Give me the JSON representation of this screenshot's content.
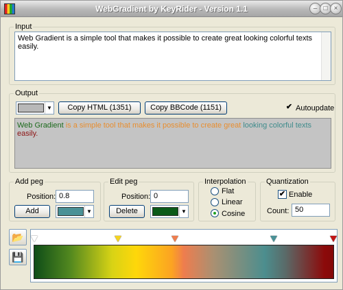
{
  "window": {
    "title": "WebGradient by KeyRider - Version 1.1"
  },
  "input": {
    "label": "Input",
    "text": "Web Gradient is a simple tool that makes it possible to create great looking colorful texts easily."
  },
  "output": {
    "label": "Output",
    "background_color": "#b8b8b8",
    "copy_html": "Copy HTML (1351)",
    "copy_bbcode": "Copy BBCode (1151)",
    "autoupdate": "Autoupdate",
    "autoupdate_checked": true,
    "preview_words": [
      {
        "text": "Web Gradient",
        "color": "#1c6a1c"
      },
      {
        "text": " is a simple tool that makes it possible to create great",
        "color": "#e88d2e"
      },
      {
        "text": " looking colorful texts",
        "color": "#3e8b8b"
      },
      {
        "text": " easily.",
        "color": "#8c1212"
      }
    ]
  },
  "add_peg": {
    "label": "Add peg",
    "position_label": "Position:",
    "position_value": "0.8",
    "add_button": "Add",
    "color": "#4a9196"
  },
  "edit_peg": {
    "label": "Edit peg",
    "position_label": "Position:",
    "position_value": "0",
    "delete_button": "Delete",
    "color": "#0b5a18"
  },
  "interpolation": {
    "label": "Interpolation",
    "options": [
      "Flat",
      "Linear",
      "Cosine"
    ],
    "selected": "Cosine"
  },
  "quantization": {
    "label": "Quantization",
    "enable_label": "Enable",
    "enabled": true,
    "count_label": "Count:",
    "count_value": "50"
  },
  "gradient": {
    "pegs": [
      {
        "position": 0.0,
        "color": "#ffffff",
        "selected": true
      },
      {
        "position": 0.28,
        "color": "#f4d321"
      },
      {
        "position": 0.47,
        "color": "#ee7d4e"
      },
      {
        "position": 0.8,
        "color": "#4a9196"
      },
      {
        "position": 1.0,
        "color": "#c01616"
      }
    ]
  },
  "icons": {
    "open": "folder-open-icon",
    "save": "floppy-disk-icon"
  }
}
